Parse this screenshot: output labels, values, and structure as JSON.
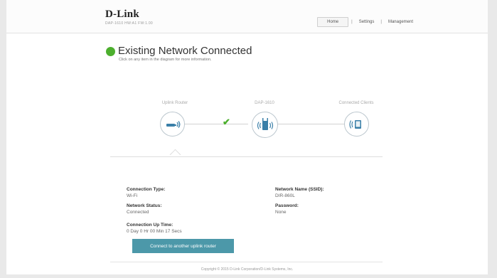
{
  "header": {
    "logo": "D-Link",
    "model_info": "DAP-1610  HW:A1  FW:1.00",
    "nav": [
      "Home",
      "Settings",
      "Management"
    ]
  },
  "status": {
    "title": "Existing Network Connected",
    "subtitle": "Click on any item in the diagram for more information.",
    "color": "#4caf2e"
  },
  "diagram": {
    "uplink_label": "Uplink Router",
    "device_label": "DAP-1610",
    "clients_label": "Connected Clients",
    "check_icon": "check-icon"
  },
  "details": {
    "connection_type_label": "Connection Type:",
    "connection_type_value": "Wi-Fi",
    "network_status_label": "Network Status:",
    "network_status_value": "Connected",
    "uptime_label": "Connection Up Time:",
    "uptime_value": "0 Day 0 Hr 00 Min 17 Secs",
    "ssid_label": "Network Name (SSID):",
    "ssid_value": "DIR-860L",
    "password_label": "Password:",
    "password_value": "None"
  },
  "button": {
    "label": "Connect to another uplink router",
    "color": "#4c98a9"
  },
  "footer": {
    "copyright": "Copyright © 2015 D-Link Corporation/D-Link Systems, Inc."
  }
}
